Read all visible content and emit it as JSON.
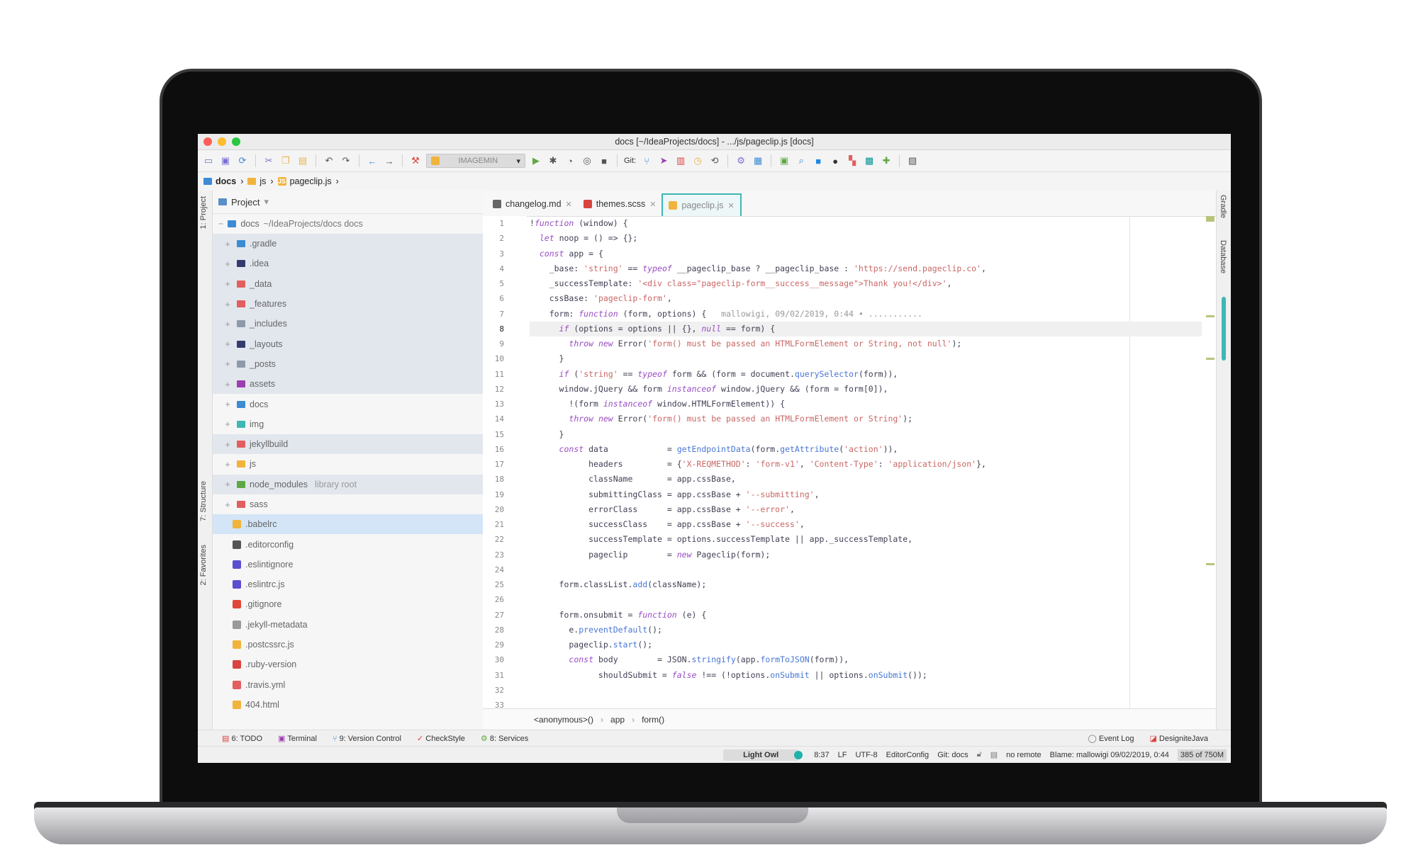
{
  "window": {
    "title": "docs [~/IdeaProjects/docs] - .../js/pageclip.js [docs]"
  },
  "toolbar": {
    "run_config": "IMAGEMIN",
    "git_label": "Git:"
  },
  "breadcrumb": [
    "docs",
    "js",
    "pageclip.js"
  ],
  "side_tabs": {
    "left": [
      "1: Project",
      "7: Structure",
      "2: Favorites"
    ],
    "right": [
      "Gradle",
      "Database"
    ]
  },
  "project": {
    "header": "Project",
    "root_name": "docs",
    "root_path": "~/IdeaProjects/docs docs",
    "items": [
      {
        "name": ".gradle",
        "type": "folder",
        "color": "#3d8bd4",
        "shaded": true
      },
      {
        "name": ".idea",
        "type": "folder",
        "color": "#333b6e",
        "shaded": true
      },
      {
        "name": "_data",
        "type": "folder",
        "color": "#e35e5e",
        "shaded": true
      },
      {
        "name": "_features",
        "type": "folder",
        "color": "#e35e5e",
        "shaded": true
      },
      {
        "name": "_includes",
        "type": "folder",
        "color": "#8e9aa8",
        "shaded": true
      },
      {
        "name": "_layouts",
        "type": "folder",
        "color": "#333b6e",
        "shaded": true
      },
      {
        "name": "_posts",
        "type": "folder",
        "color": "#8e9aa8",
        "shaded": true
      },
      {
        "name": "assets",
        "type": "folder",
        "color": "#9b3fb0",
        "shaded": true
      },
      {
        "name": "docs",
        "type": "folder",
        "color": "#3d8bd4",
        "shaded": false
      },
      {
        "name": "img",
        "type": "folder",
        "color": "#3fb7b4",
        "shaded": false
      },
      {
        "name": "jekyllbuild",
        "type": "folder",
        "color": "#e35e5e",
        "shaded": true
      },
      {
        "name": "js",
        "type": "folder",
        "color": "#f0b43c",
        "shaded": false
      },
      {
        "name": "node_modules",
        "sub": "library root",
        "type": "folder",
        "color": "#5fa845",
        "shaded": true
      },
      {
        "name": "sass",
        "type": "folder",
        "color": "#e35e5e",
        "shaded": false
      },
      {
        "name": ".babelrc",
        "type": "file",
        "color": "#f0b43c",
        "selected": true
      },
      {
        "name": ".editorconfig",
        "type": "file",
        "color": "#555"
      },
      {
        "name": ".eslintignore",
        "type": "file",
        "color": "#5b4fcf"
      },
      {
        "name": ".eslintrc.js",
        "type": "file",
        "color": "#5b4fcf"
      },
      {
        "name": ".gitignore",
        "type": "file",
        "color": "#e0463a"
      },
      {
        "name": ".jekyll-metadata",
        "type": "file",
        "color": "#999"
      },
      {
        "name": ".postcssrc.js",
        "type": "file",
        "color": "#f0b43c"
      },
      {
        "name": ".ruby-version",
        "type": "file",
        "color": "#d9443f"
      },
      {
        "name": ".travis.yml",
        "type": "file",
        "color": "#e35e5e"
      },
      {
        "name": "404.html",
        "type": "file",
        "color": "#f0b43c"
      }
    ]
  },
  "tabs": [
    {
      "label": "changelog.md",
      "active": false,
      "icon_color": "#666"
    },
    {
      "label": "themes.scss",
      "active": false,
      "icon_color": "#d9443f"
    },
    {
      "label": "pageclip.js",
      "active": true,
      "icon_color": "#f0b43c"
    }
  ],
  "editor": {
    "current_line": 8,
    "lines": [
      "!function (window) {",
      "  let noop = () => {};",
      "  const app = {",
      "    _base: 'string' == typeof __pageclip_base ? __pageclip_base : 'https://send.pageclip.co',",
      "    _successTemplate: '<div class=\"pageclip-form__success__message\">Thank you!</div>',",
      "    cssBase: 'pageclip-form',",
      "    form: function (form, options) {   mallowigi, 09/02/2019, 0:44 • ...........",
      "      if (options = options || {}, null == form) {",
      "        throw new Error('form() must be passed an HTMLFormElement or String, not null');",
      "      }",
      "      if ('string' == typeof form && (form = document.querySelector(form)),",
      "      window.jQuery && form instanceof window.jQuery && (form = form[0]),",
      "        !(form instanceof window.HTMLFormElement)) {",
      "        throw new Error('form() must be passed an HTMLFormElement or String');",
      "      }",
      "      const data            = getEndpointData(form.getAttribute('action')),",
      "            headers         = {'X-REQMETHOD': 'form-v1', 'Content-Type': 'application/json'},",
      "            className       = app.cssBase,",
      "            submittingClass = app.cssBase + '--submitting',",
      "            errorClass      = app.cssBase + '--error',",
      "            successClass    = app.cssBase + '--success',",
      "            successTemplate = options.successTemplate || app._successTemplate,",
      "            pageclip        = new Pageclip(form);",
      "",
      "      form.classList.add(className);",
      "",
      "      form.onsubmit = function (e) {",
      "        e.preventDefault();",
      "        pageclip.start();",
      "        const body        = JSON.stringify(app.formToJSON(form)),",
      "              shouldSubmit = false !== (!options.onSubmit || options.onSubmit());",
      "",
      ""
    ]
  },
  "code_breadcrumb": [
    "<anonymous>()",
    "app",
    "form()"
  ],
  "tool_windows": {
    "left": [
      "6: TODO",
      "Terminal",
      "9: Version Control",
      "CheckStyle",
      "8: Services"
    ],
    "right": [
      "Event Log",
      "DesigniteJava"
    ]
  },
  "status": {
    "theme": "Light Owl",
    "position": "8:37",
    "line_sep": "LF",
    "encoding": "UTF-8",
    "editorconfig": "EditorConfig",
    "git": "Git: docs",
    "remote": "no remote",
    "blame": "Blame: mallowigi 09/02/2019, 0:44",
    "memory": "385 of 750M"
  },
  "colors": {
    "accent": "#3fb7b4",
    "keyword": "#994cc3",
    "string": "#c96765",
    "function": "#4876d6"
  }
}
